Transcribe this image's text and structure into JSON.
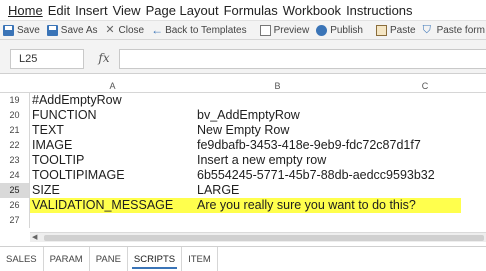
{
  "menu": [
    "Home",
    "Edit",
    "Insert",
    "View",
    "Page Layout",
    "Formulas",
    "Workbook",
    "Instructions"
  ],
  "toolbar": {
    "save": "Save",
    "save_as": "Save As",
    "close": "Close",
    "back": "Back to Templates",
    "preview": "Preview",
    "publish": "Publish",
    "paste": "Paste",
    "paste_format": "Paste form"
  },
  "formula_bar": {
    "cell_ref": "L25",
    "fx": "fx",
    "value": ""
  },
  "columns": [
    "A",
    "B",
    "C"
  ],
  "rows": [
    {
      "num": "19",
      "a": "#AddEmptyRow",
      "b": ""
    },
    {
      "num": "20",
      "a": "FUNCTION",
      "b": "bv_AddEmptyRow"
    },
    {
      "num": "21",
      "a": "TEXT",
      "b": "New Empty Row"
    },
    {
      "num": "22",
      "a": "IMAGE",
      "b": "fe9dbafb-3453-418e-9eb9-fdc72c87d1f7"
    },
    {
      "num": "23",
      "a": "TOOLTIP",
      "b": "Insert a new empty row"
    },
    {
      "num": "24",
      "a": "TOOLTIPIMAGE",
      "b": "6b554245-5771-45b7-88db-aedcc9593b32"
    },
    {
      "num": "25",
      "a": "SIZE",
      "b": "LARGE"
    },
    {
      "num": "26",
      "a": "VALIDATION_MESSAGE",
      "b": "Are you really sure you want to do this?"
    },
    {
      "num": "27",
      "a": "",
      "b": ""
    }
  ],
  "selected_row": "25",
  "highlight_row": "26",
  "highlight_color": "#ffff4d",
  "sheet_tabs": [
    "SALES",
    "PARAM",
    "PANE",
    "SCRIPTS",
    "ITEM"
  ],
  "active_tab": "SCRIPTS",
  "colors": {
    "accent": "#3a74b7",
    "toolbar_bg": "#f3f3f3"
  }
}
